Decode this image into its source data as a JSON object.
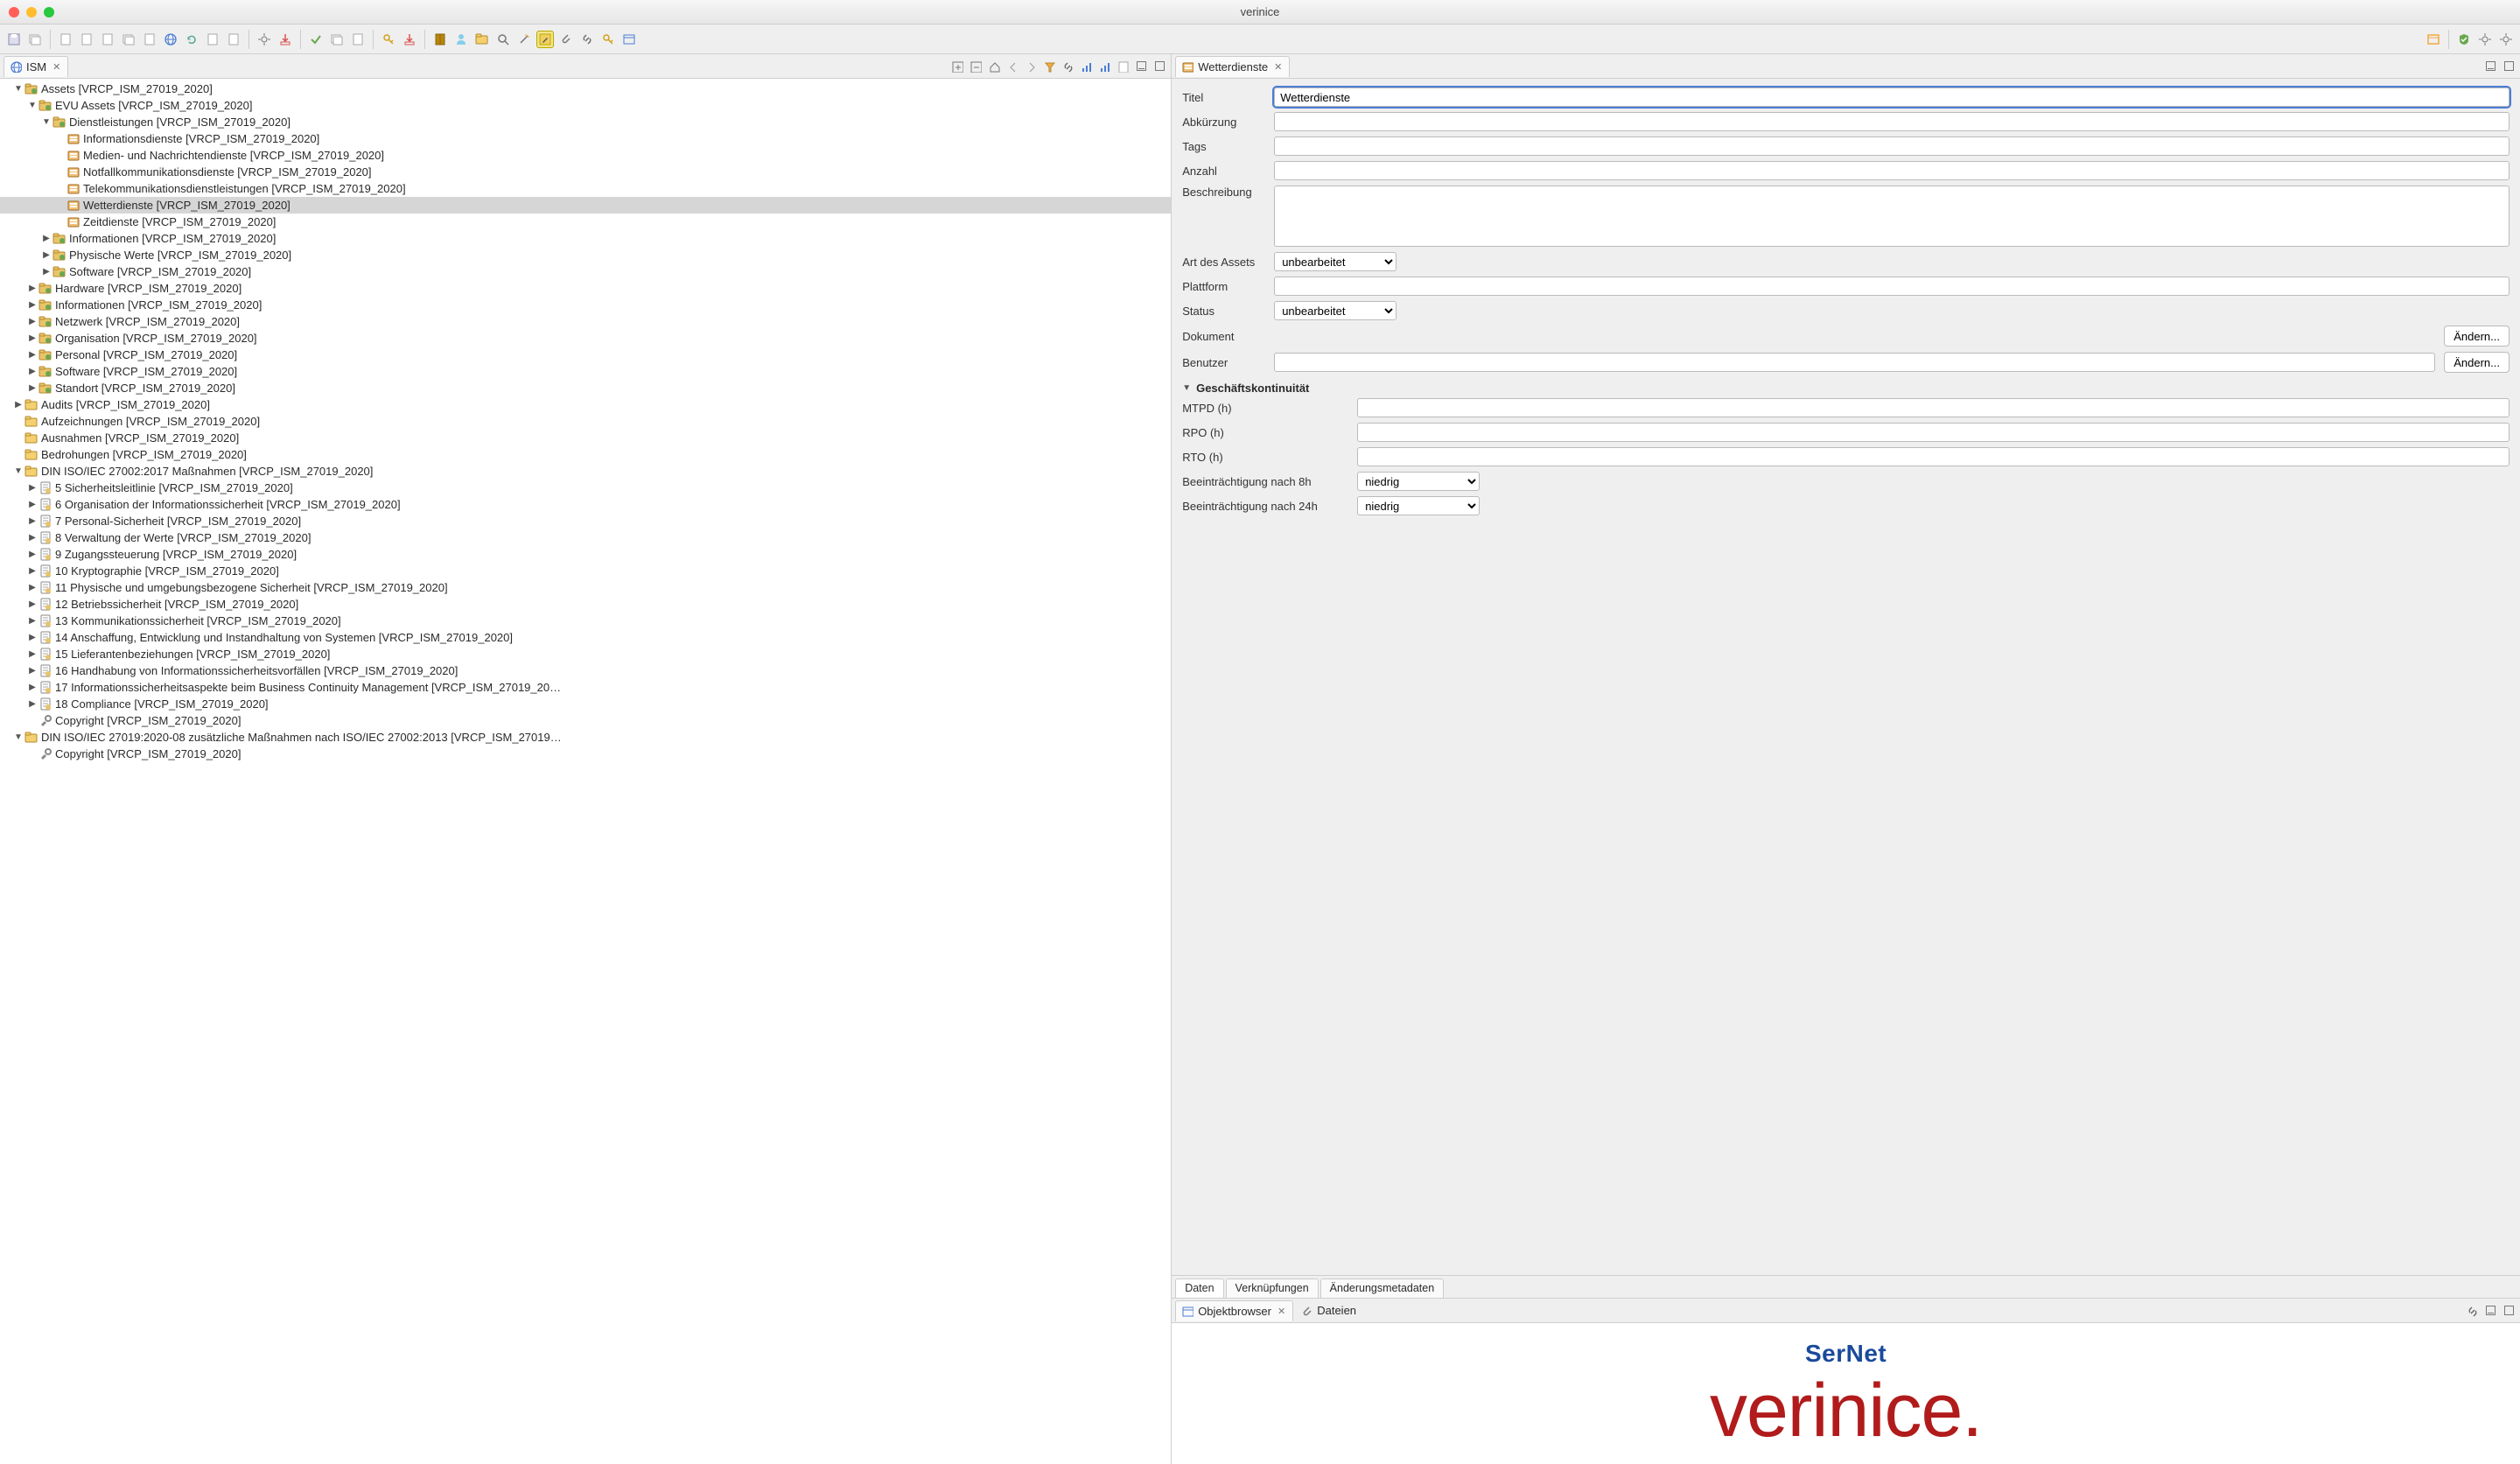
{
  "window": {
    "title": "verinice"
  },
  "left_view": {
    "title": "ISM"
  },
  "tree": [
    {
      "d": 0,
      "exp": "open",
      "icon": "folder-g",
      "label": "Assets [VRCP_ISM_27019_2020]"
    },
    {
      "d": 1,
      "exp": "open",
      "icon": "folder-g",
      "label": "EVU Assets [VRCP_ISM_27019_2020]"
    },
    {
      "d": 2,
      "exp": "open",
      "icon": "folder-g",
      "label": "Dienstleistungen [VRCP_ISM_27019_2020]"
    },
    {
      "d": 3,
      "exp": "none",
      "icon": "asset",
      "label": "Informationsdienste [VRCP_ISM_27019_2020]"
    },
    {
      "d": 3,
      "exp": "none",
      "icon": "asset",
      "label": "Medien- und Nachrichtendienste [VRCP_ISM_27019_2020]"
    },
    {
      "d": 3,
      "exp": "none",
      "icon": "asset",
      "label": "Notfallkommunikationsdienste [VRCP_ISM_27019_2020]"
    },
    {
      "d": 3,
      "exp": "none",
      "icon": "asset",
      "label": "Telekommunikationsdienstleistungen [VRCP_ISM_27019_2020]"
    },
    {
      "d": 3,
      "exp": "none",
      "icon": "asset",
      "label": "Wetterdienste [VRCP_ISM_27019_2020]",
      "selected": true
    },
    {
      "d": 3,
      "exp": "none",
      "icon": "asset",
      "label": "Zeitdienste [VRCP_ISM_27019_2020]"
    },
    {
      "d": 2,
      "exp": "closed",
      "icon": "folder-g",
      "label": "Informationen [VRCP_ISM_27019_2020]"
    },
    {
      "d": 2,
      "exp": "closed",
      "icon": "folder-g",
      "label": "Physische Werte [VRCP_ISM_27019_2020]"
    },
    {
      "d": 2,
      "exp": "closed",
      "icon": "folder-g",
      "label": "Software [VRCP_ISM_27019_2020]"
    },
    {
      "d": 1,
      "exp": "closed",
      "icon": "folder-g",
      "label": "Hardware [VRCP_ISM_27019_2020]"
    },
    {
      "d": 1,
      "exp": "closed",
      "icon": "folder-g",
      "label": "Informationen [VRCP_ISM_27019_2020]"
    },
    {
      "d": 1,
      "exp": "closed",
      "icon": "folder-g",
      "label": "Netzwerk [VRCP_ISM_27019_2020]"
    },
    {
      "d": 1,
      "exp": "closed",
      "icon": "folder-g",
      "label": "Organisation [VRCP_ISM_27019_2020]"
    },
    {
      "d": 1,
      "exp": "closed",
      "icon": "folder-g",
      "label": "Personal [VRCP_ISM_27019_2020]"
    },
    {
      "d": 1,
      "exp": "closed",
      "icon": "folder-g",
      "label": "Software [VRCP_ISM_27019_2020]"
    },
    {
      "d": 1,
      "exp": "closed",
      "icon": "folder-g",
      "label": "Standort [VRCP_ISM_27019_2020]"
    },
    {
      "d": 0,
      "exp": "closed",
      "icon": "folder-y",
      "label": "Audits [VRCP_ISM_27019_2020]"
    },
    {
      "d": 0,
      "exp": "none",
      "icon": "folder-y",
      "label": "Aufzeichnungen [VRCP_ISM_27019_2020]"
    },
    {
      "d": 0,
      "exp": "none",
      "icon": "folder-y",
      "label": "Ausnahmen [VRCP_ISM_27019_2020]"
    },
    {
      "d": 0,
      "exp": "none",
      "icon": "folder-y",
      "label": "Bedrohungen [VRCP_ISM_27019_2020]"
    },
    {
      "d": 0,
      "exp": "open",
      "icon": "folder-y",
      "label": "DIN ISO/IEC 27002:2017 Maßnahmen [VRCP_ISM_27019_2020]"
    },
    {
      "d": 1,
      "exp": "closed",
      "icon": "doc",
      "label": "5 Sicherheitsleitlinie [VRCP_ISM_27019_2020]"
    },
    {
      "d": 1,
      "exp": "closed",
      "icon": "doc",
      "label": "6 Organisation der Informationssicherheit [VRCP_ISM_27019_2020]"
    },
    {
      "d": 1,
      "exp": "closed",
      "icon": "doc",
      "label": "7 Personal-Sicherheit [VRCP_ISM_27019_2020]"
    },
    {
      "d": 1,
      "exp": "closed",
      "icon": "doc",
      "label": "8 Verwaltung der Werte [VRCP_ISM_27019_2020]"
    },
    {
      "d": 1,
      "exp": "closed",
      "icon": "doc",
      "label": "9 Zugangssteuerung [VRCP_ISM_27019_2020]"
    },
    {
      "d": 1,
      "exp": "closed",
      "icon": "doc",
      "label": "10 Kryptographie [VRCP_ISM_27019_2020]"
    },
    {
      "d": 1,
      "exp": "closed",
      "icon": "doc",
      "label": "11 Physische und umgebungsbezogene Sicherheit [VRCP_ISM_27019_2020]"
    },
    {
      "d": 1,
      "exp": "closed",
      "icon": "doc",
      "label": "12 Betriebssicherheit [VRCP_ISM_27019_2020]"
    },
    {
      "d": 1,
      "exp": "closed",
      "icon": "doc",
      "label": "13 Kommunikationssicherheit [VRCP_ISM_27019_2020]"
    },
    {
      "d": 1,
      "exp": "closed",
      "icon": "doc",
      "label": "14 Anschaffung, Entwicklung und Instandhaltung von Systemen [VRCP_ISM_27019_2020]"
    },
    {
      "d": 1,
      "exp": "closed",
      "icon": "doc",
      "label": "15 Lieferantenbeziehungen [VRCP_ISM_27019_2020]"
    },
    {
      "d": 1,
      "exp": "closed",
      "icon": "doc",
      "label": "16 Handhabung von Informationssicherheitsvorfällen [VRCP_ISM_27019_2020]"
    },
    {
      "d": 1,
      "exp": "closed",
      "icon": "doc",
      "label": "17 Informationssicherheitsaspekte beim Business Continuity Management [VRCP_ISM_27019_20…"
    },
    {
      "d": 1,
      "exp": "closed",
      "icon": "doc",
      "label": "18 Compliance [VRCP_ISM_27019_2020]"
    },
    {
      "d": 1,
      "exp": "none",
      "icon": "tool",
      "label": "Copyright [VRCP_ISM_27019_2020]"
    },
    {
      "d": 0,
      "exp": "open",
      "icon": "folder-y",
      "label": "DIN ISO/IEC 27019:2020-08 zusätzliche Maßnahmen nach ISO/IEC 27002:2013 [VRCP_ISM_27019…"
    },
    {
      "d": 1,
      "exp": "none",
      "icon": "tool",
      "label": "Copyright [VRCP_ISM_27019_2020]"
    }
  ],
  "editor": {
    "tab_title": "Wetterdienste",
    "labels": {
      "titel": "Titel",
      "abkuerzung": "Abkürzung",
      "tags": "Tags",
      "anzahl": "Anzahl",
      "beschreibung": "Beschreibung",
      "art": "Art des Assets",
      "plattform": "Plattform",
      "status": "Status",
      "dokument": "Dokument",
      "benutzer": "Benutzer",
      "aendern": "Ändern...",
      "section": "Geschäftskontinuität",
      "mtpd": "MTPD (h)",
      "rpo": "RPO (h)",
      "rto": "RTO (h)",
      "beein8": "Beeinträchtigung nach 8h",
      "beein24": "Beeinträchtigung nach 24h"
    },
    "values": {
      "titel": "Wetterdienste",
      "abkuerzung": "",
      "tags": "",
      "anzahl": "",
      "beschreibung": "",
      "art": "unbearbeitet",
      "plattform": "",
      "status": "unbearbeitet",
      "benutzer": "",
      "mtpd": "",
      "rpo": "",
      "rto": "",
      "beein8": "niedrig",
      "beein24": "niedrig"
    },
    "bottom_tabs": [
      "Daten",
      "Verknüpfungen",
      "Änderungsmetadaten"
    ]
  },
  "bottom": {
    "tabs": [
      {
        "label": "Objektbrowser",
        "closable": true,
        "icon": "browser"
      },
      {
        "label": "Dateien",
        "closable": false,
        "icon": "attach"
      }
    ],
    "logo": {
      "ser": "SerNet",
      "verinice": "verinice."
    }
  }
}
